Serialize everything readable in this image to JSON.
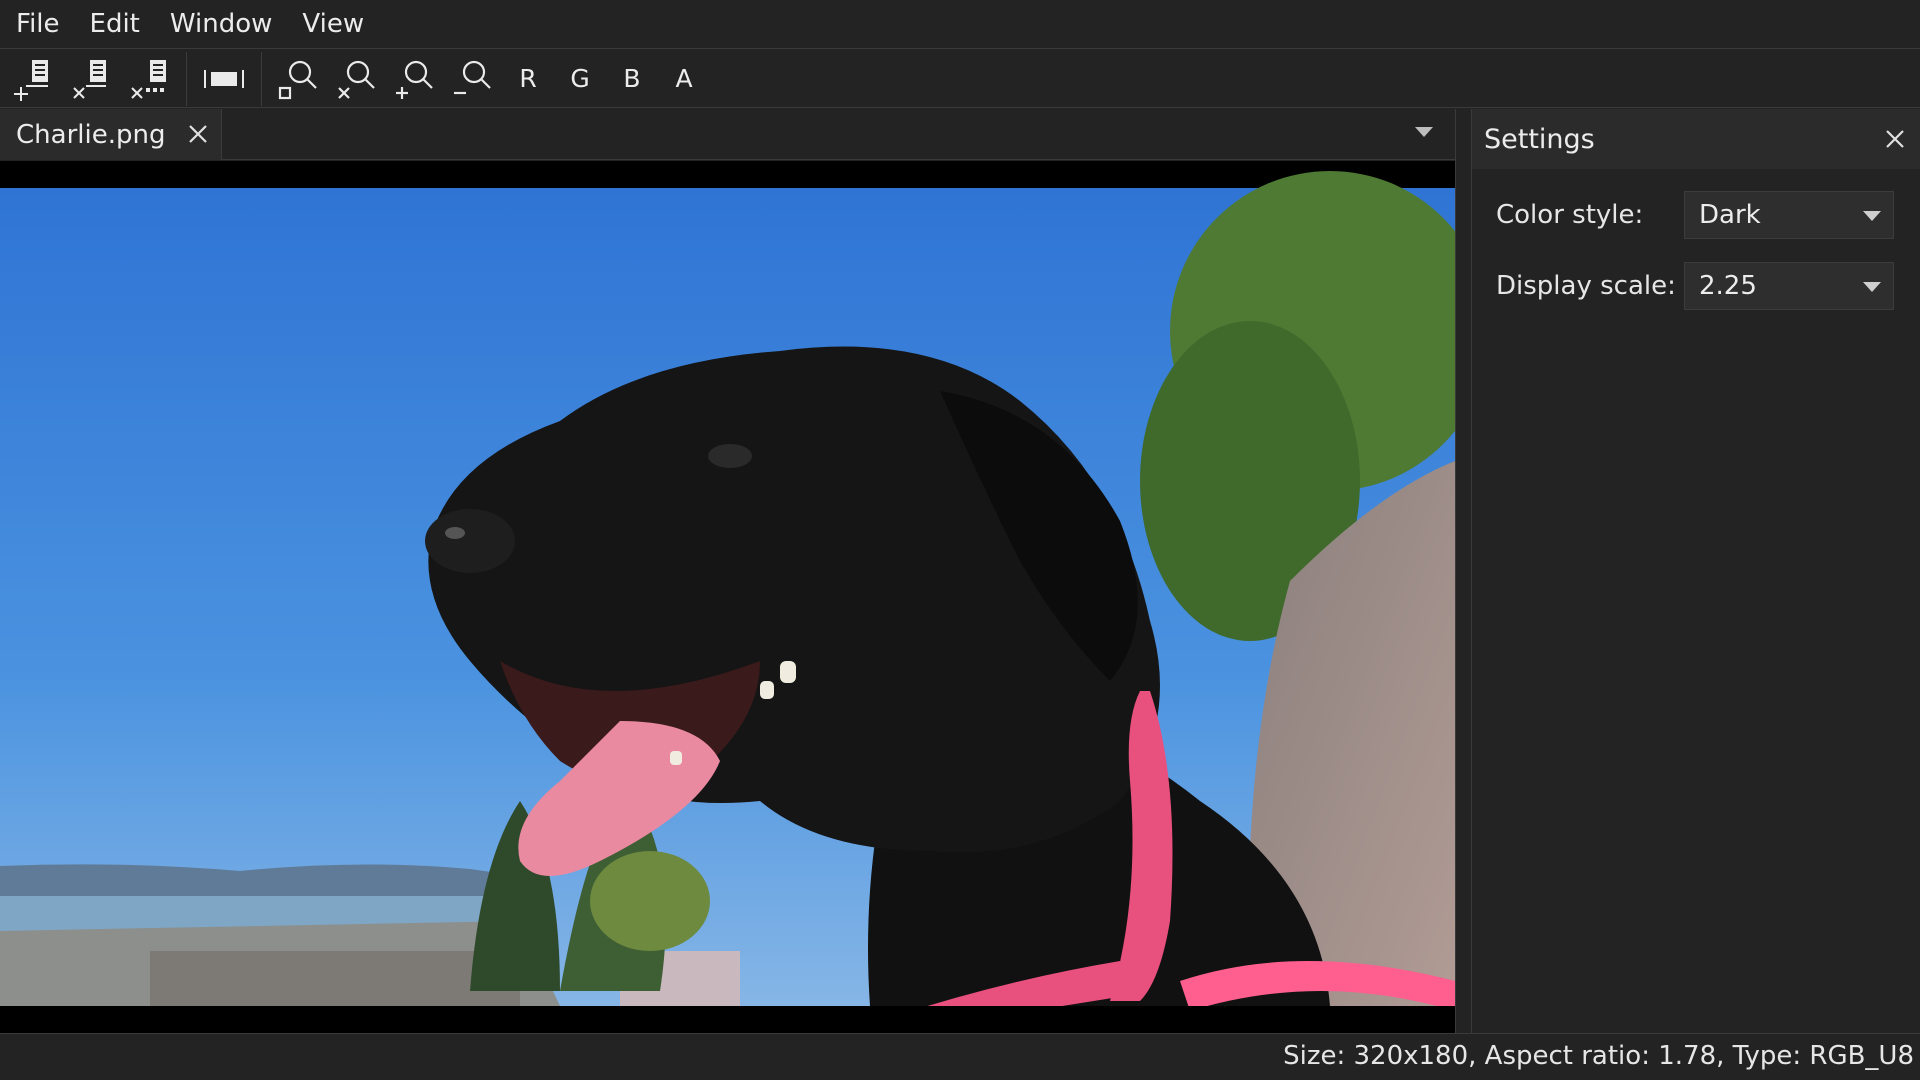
{
  "menu": {
    "items": [
      "File",
      "Edit",
      "Window",
      "View"
    ]
  },
  "toolbar": {
    "file_buttons": [
      "open-file-icon",
      "close-file-icon",
      "close-all-files-icon"
    ],
    "fit_button": "fit-to-window-icon",
    "zoom_buttons": [
      "zoom-reset-icon",
      "zoom-fit-icon",
      "zoom-in-icon",
      "zoom-out-icon"
    ],
    "channels": [
      "R",
      "G",
      "B",
      "A"
    ]
  },
  "tabs": [
    {
      "label": "Charlie.png",
      "close_icon": "close-icon"
    }
  ],
  "image": {
    "subject": "photo",
    "colors": {
      "sky": "#3d86d8",
      "letterbox": "#000000"
    }
  },
  "settings": {
    "title": "Settings",
    "color_style": {
      "label": "Color style:",
      "value": "Dark"
    },
    "display_scale": {
      "label": "Display scale:",
      "value": "2.25"
    }
  },
  "status": {
    "text": "Size: 320x180, Aspect ratio: 1.78, Type: RGB_U8"
  },
  "colors": {
    "background": "#232323",
    "panel_header": "#2b2b2b",
    "text": "#ececec",
    "border": "#3a3a3a"
  }
}
